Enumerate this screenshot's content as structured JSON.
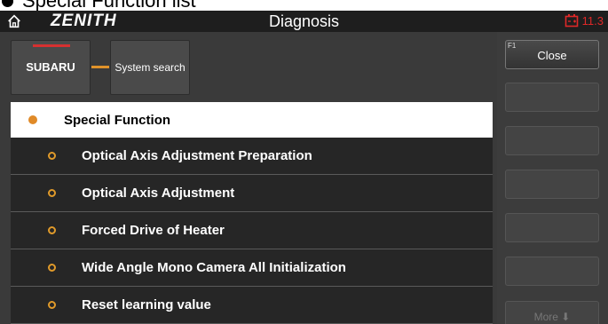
{
  "caption": {
    "text": "Special Function list"
  },
  "titlebar": {
    "logo": "ZENITH",
    "title": "Diagnosis",
    "battery_value": "11.3"
  },
  "breadcrumb": {
    "brand": "SUBARU",
    "system": "System search"
  },
  "list": {
    "header": "Special Function",
    "items": [
      {
        "label": "Optical Axis Adjustment Preparation"
      },
      {
        "label": "Optical Axis Adjustment"
      },
      {
        "label": "Forced Drive of Heater"
      },
      {
        "label": "Wide Angle Mono Camera All Initialization"
      },
      {
        "label": "Reset learning value"
      }
    ]
  },
  "sidebar": {
    "close_fkey": "F1",
    "close_label": "Close",
    "more_label": "More ⬇"
  },
  "colors": {
    "accent": "#e08a28",
    "brand_red": "#d63030",
    "battery": "#e02828"
  },
  "icons": {
    "home": "home-icon",
    "battery": "battery-icon"
  }
}
